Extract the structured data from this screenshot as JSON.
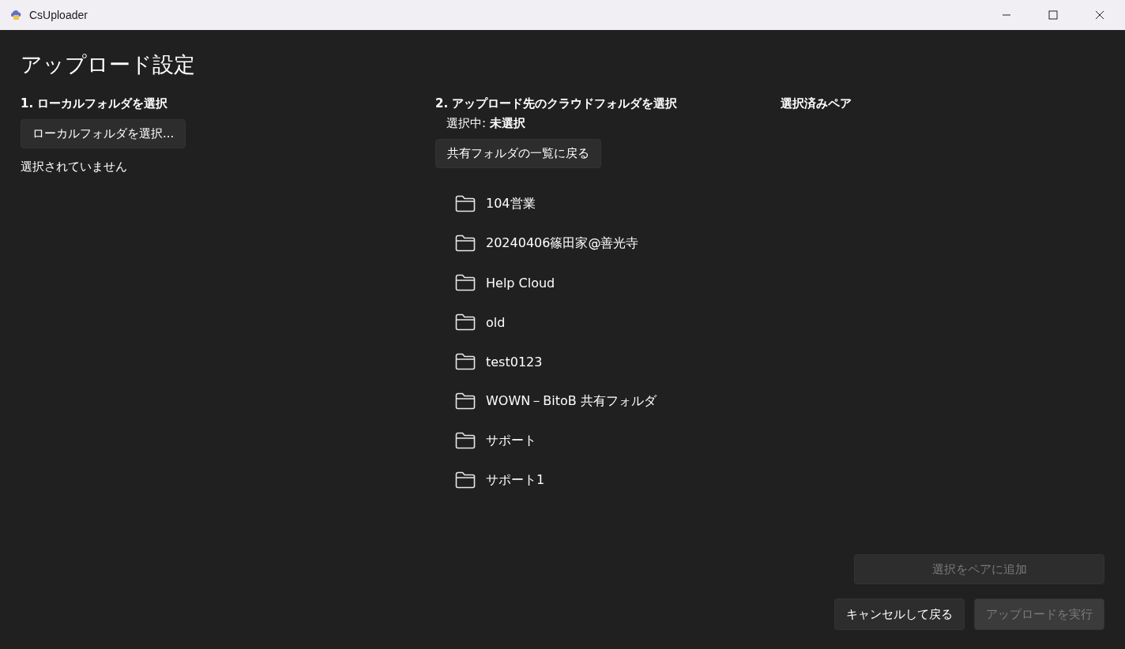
{
  "window": {
    "title": "CsUploader"
  },
  "page_title": "アップロード設定",
  "local": {
    "heading": "1. ローカルフォルダを選択",
    "button": "ローカルフォルダを選択...",
    "status": "選択されていません"
  },
  "cloud": {
    "heading": "2. アップロード先のクラウドフォルダを選択",
    "current": "選択中: **未選択**",
    "back_button": "共有フォルダの一覧に戻る",
    "folders": [
      {
        "name": "104営業"
      },
      {
        "name": "20240406篠田家@善光寺"
      },
      {
        "name": "Help Cloud"
      },
      {
        "name": "old"
      },
      {
        "name": "test0123"
      },
      {
        "name": "WOWN－BitoB 共有フォルダ"
      },
      {
        "name": "サポート"
      },
      {
        "name": "サポート1"
      }
    ]
  },
  "pairs": {
    "heading": "選択済みペア"
  },
  "add_pair_button": {
    "label": "選択をペアに追加",
    "disabled": true
  },
  "footer_buttons": [
    {
      "label": "キャンセルして戻る",
      "disabled": false,
      "kind": "secondary"
    },
    {
      "label": "アップロードを実行",
      "disabled": true,
      "kind": "primary"
    }
  ]
}
